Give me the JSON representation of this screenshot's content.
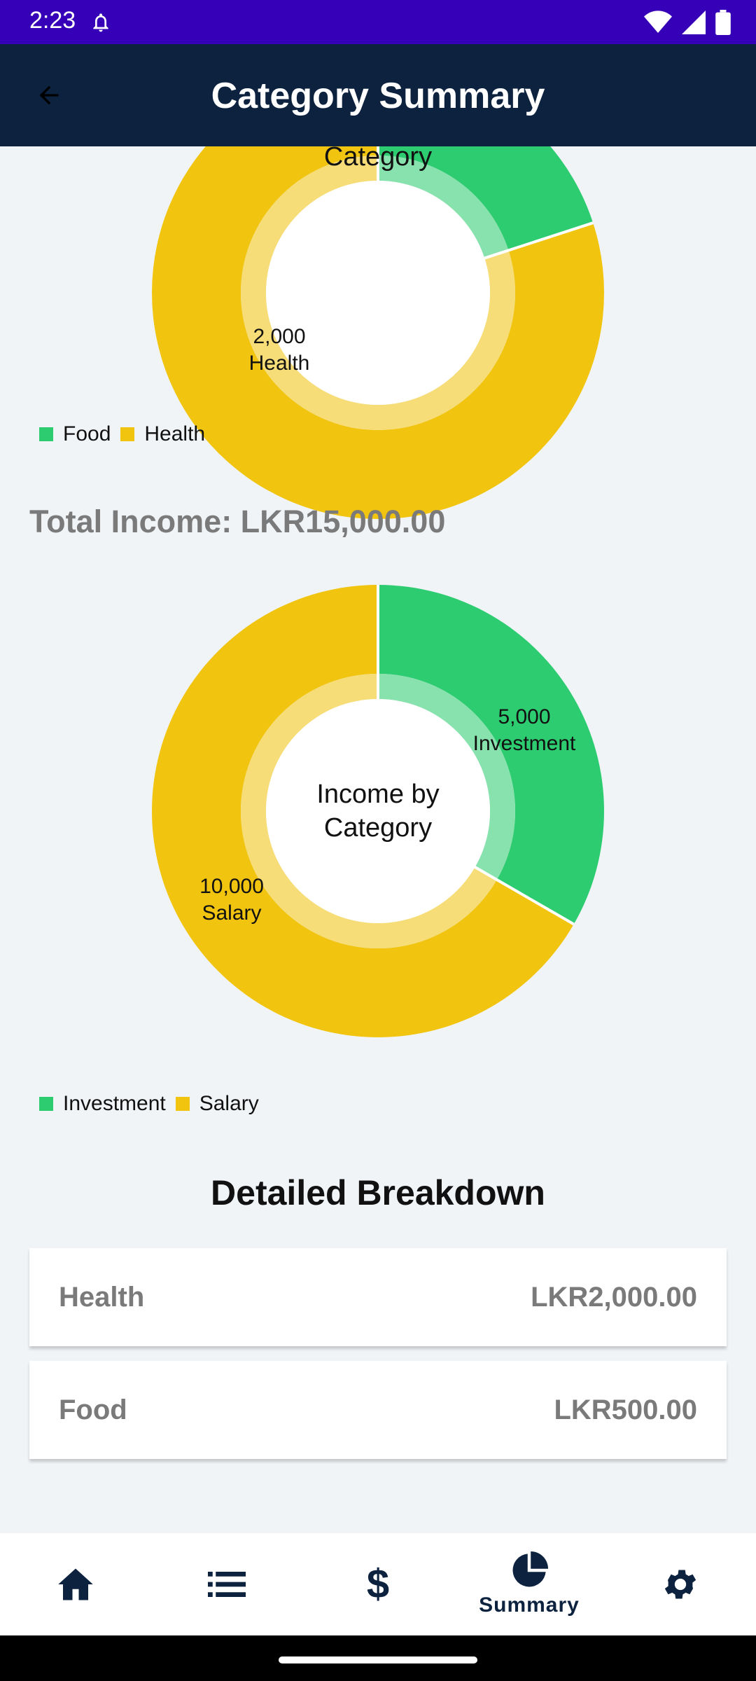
{
  "status": {
    "time": "2:23"
  },
  "app_bar": {
    "title": "Category Summary"
  },
  "expense_chart": {
    "center_label": "Category",
    "slice_label_value": "2,000",
    "slice_label_name": "Health",
    "legend": [
      {
        "label": "Food",
        "color": "#2ecc71"
      },
      {
        "label": "Health",
        "color": "#f1c40f"
      }
    ]
  },
  "income": {
    "total_label": "Total Income: LKR15,000.00"
  },
  "income_chart": {
    "center_line1": "Income by",
    "center_line2": "Category",
    "investment_value": "5,000",
    "investment_name": "Investment",
    "salary_value": "10,000",
    "salary_name": "Salary",
    "legend": [
      {
        "label": "Investment",
        "color": "#2ecc71"
      },
      {
        "label": "Salary",
        "color": "#f1c40f"
      }
    ]
  },
  "breakdown": {
    "title": "Detailed Breakdown",
    "rows": [
      {
        "label": "Health",
        "amount": "LKR2,000.00"
      },
      {
        "label": "Food",
        "amount": "LKR500.00"
      }
    ]
  },
  "bottom_nav": {
    "items": [
      {
        "icon": "home-icon",
        "label": ""
      },
      {
        "icon": "list-icon",
        "label": ""
      },
      {
        "icon": "dollar-icon",
        "label": ""
      },
      {
        "icon": "pie-chart-icon",
        "label": "Summary"
      },
      {
        "icon": "gear-icon",
        "label": ""
      }
    ]
  },
  "chart_data": [
    {
      "type": "pie",
      "title": "",
      "categories": [
        "Food",
        "Health"
      ],
      "values": [
        500,
        2000
      ],
      "legend": "bottom-left"
    },
    {
      "type": "pie",
      "title": "Income by Category",
      "categories": [
        "Investment",
        "Salary"
      ],
      "values": [
        5000,
        10000
      ],
      "legend": "bottom-left"
    }
  ]
}
